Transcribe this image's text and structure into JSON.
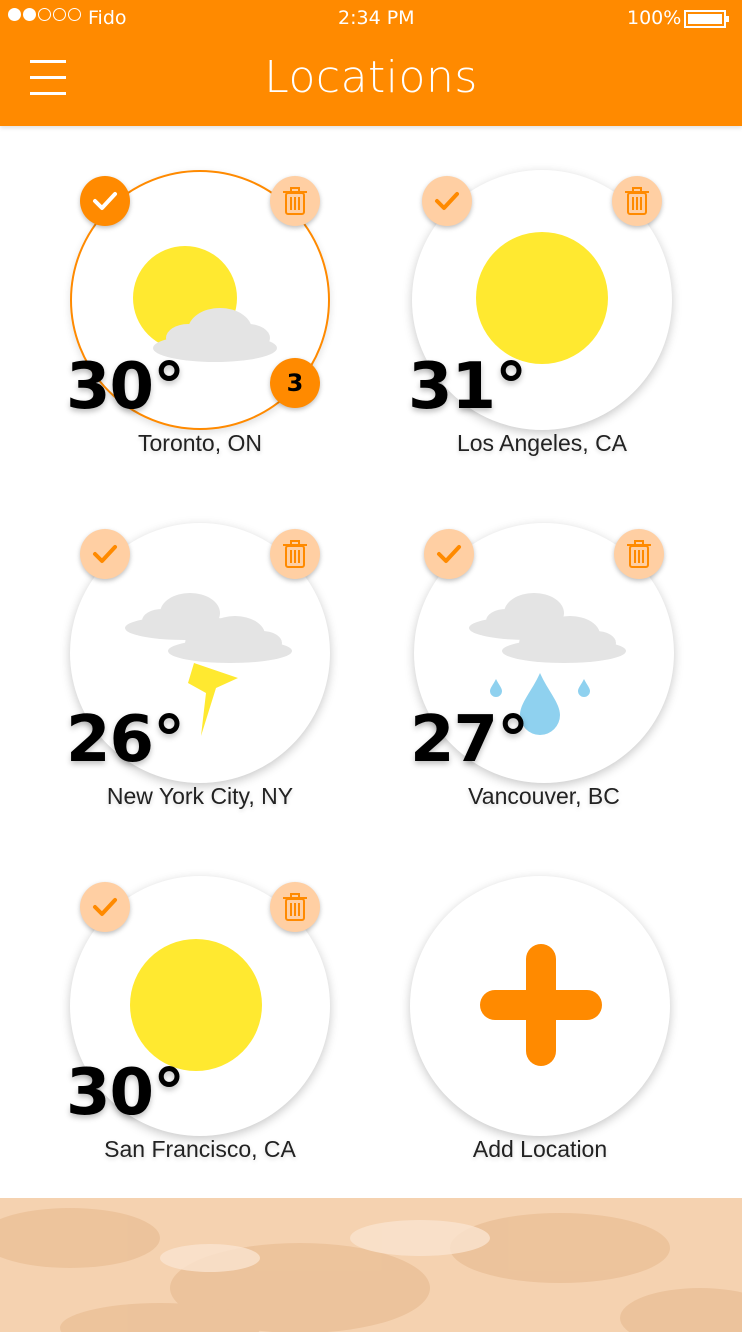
{
  "status_bar": {
    "carrier": "Fido",
    "time": "2:34 PM",
    "battery": "100%",
    "signal_bars_filled": 2,
    "signal_bars_total": 5
  },
  "header": {
    "title": "Locations",
    "menu_icon": "hamburger-menu-icon"
  },
  "colors": {
    "accent": "#ff8a00",
    "accent_light": "#ffcfa3",
    "sun": "#ffe930",
    "cloud": "#e4e4e4",
    "rain": "#8fd1ef"
  },
  "locations": [
    {
      "temp": "30°",
      "city": "Toronto, ON",
      "weather": "sun-cloud",
      "selected": true,
      "count": "3"
    },
    {
      "temp": "31°",
      "city": "Los Angeles, CA",
      "weather": "sun",
      "selected": false
    },
    {
      "temp": "26°",
      "city": "New York City, NY",
      "weather": "thunderstorm",
      "selected": false
    },
    {
      "temp": "27°",
      "city": "Vancouver, BC",
      "weather": "rain",
      "selected": false
    },
    {
      "temp": "30°",
      "city": "San Francisco, CA",
      "weather": "sun",
      "selected": false
    }
  ],
  "add_location": {
    "label": "Add Location",
    "icon": "plus-icon"
  }
}
